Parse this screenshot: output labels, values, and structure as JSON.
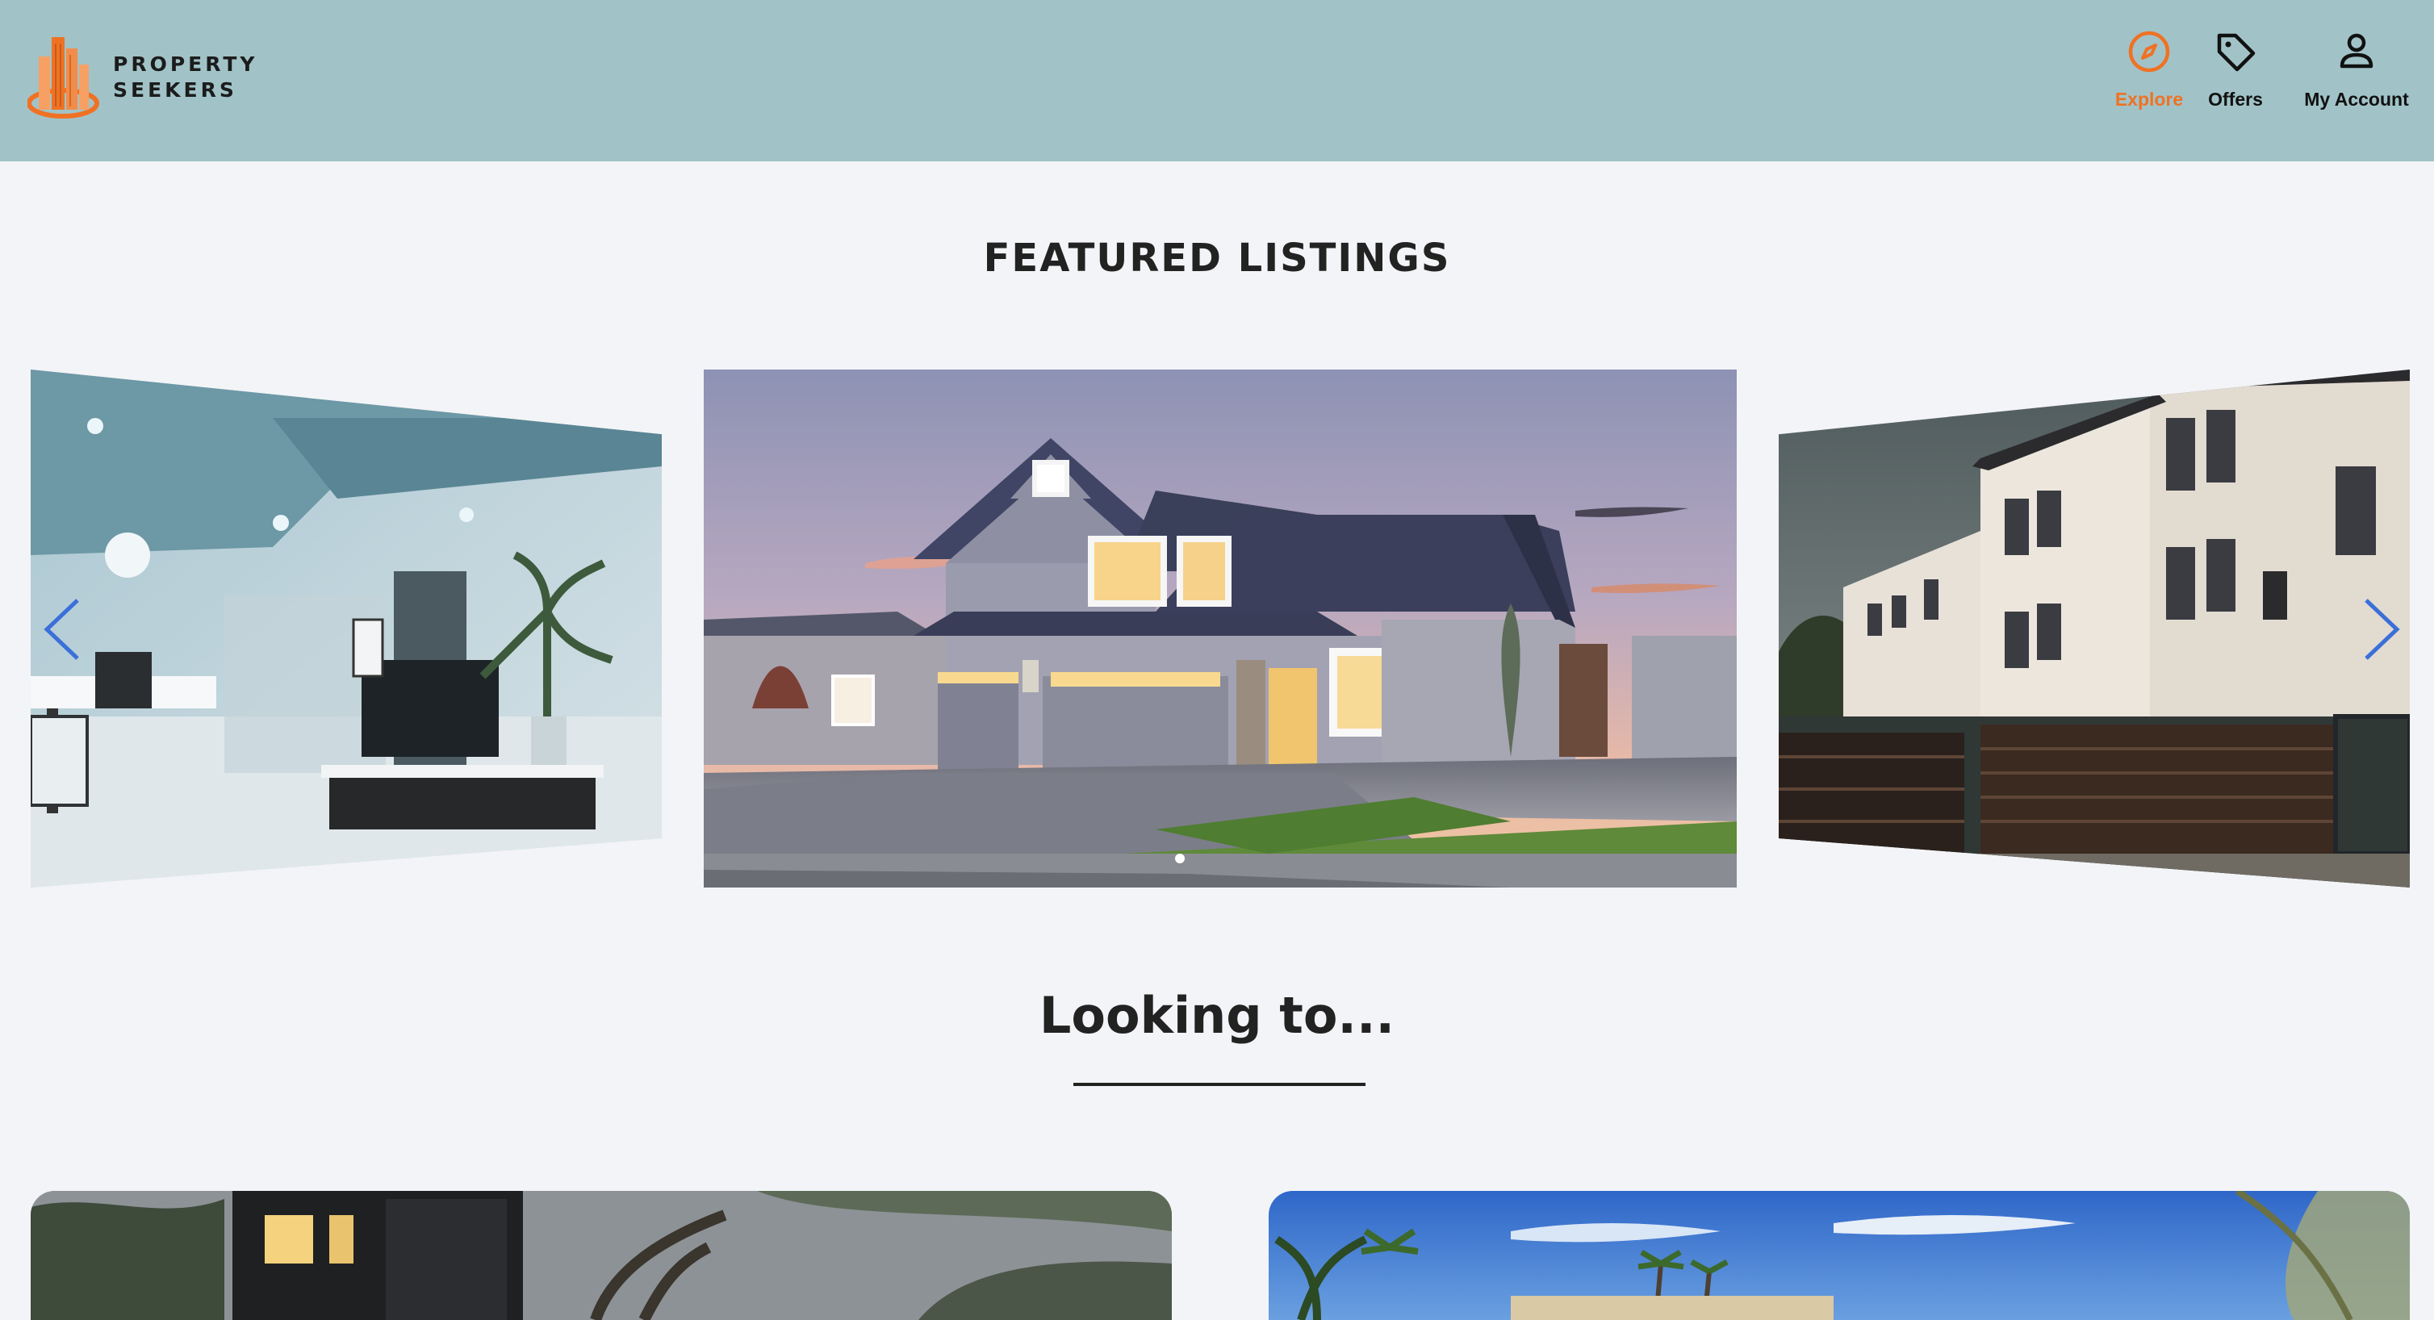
{
  "brand": {
    "line1": "PROPERTY",
    "line2": "SEEKERS",
    "logo_icon": "building-logo-icon",
    "colors": {
      "orange": "#ef7224",
      "header_bg": "#a1c3c8"
    }
  },
  "nav": {
    "items": [
      {
        "label": "Explore",
        "icon": "compass-icon",
        "active": true
      },
      {
        "label": "Offers",
        "icon": "tag-icon",
        "active": false
      },
      {
        "label": "My Account",
        "icon": "user-icon",
        "active": false
      }
    ]
  },
  "featured": {
    "title": "FEATURED LISTINGS",
    "slides": [
      {
        "subject": "modern-interior-photo"
      },
      {
        "subject": "suburban-house-photo"
      },
      {
        "subject": "townhouses-photo"
      }
    ],
    "arrows": {
      "prev": "chevron-left-icon",
      "next": "chevron-right-icon",
      "color": "#3b6fd9"
    }
  },
  "looking": {
    "title": "Looking to..."
  }
}
